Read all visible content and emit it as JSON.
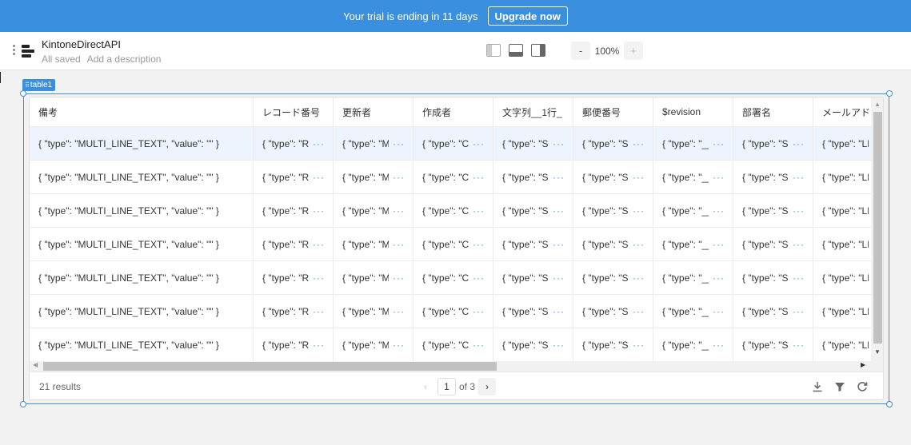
{
  "banner": {
    "text": "Your trial is ending in 11 days",
    "upgrade_label": "Upgrade now"
  },
  "header": {
    "app_name": "KintoneDirectAPI",
    "save_status": "All saved",
    "description_placeholder": "Add a description",
    "zoom": {
      "minus": "-",
      "value": "100%",
      "plus": "+"
    }
  },
  "component": {
    "tag_label": "table1"
  },
  "table": {
    "columns": [
      "備考",
      "レコード番号",
      "更新者",
      "作成者",
      "文字列__1行_",
      "郵便番号",
      "$revision",
      "部署名",
      "メールアドレス"
    ],
    "rows": [
      [
        "{ \"type\": \"MULTI_LINE_TEXT\", \"value\": \"\" }",
        "{ \"type\": \"RECORD_NUMBER\"",
        "{ \"type\": \"MODIFIER\"",
        "{ \"type\": \"CREATOR\"",
        "{ \"type\": \"SINGLE_LINE_TEXT\"",
        "{ \"type\": \"SINGLE_LINE_TEXT\"",
        "{ \"type\": \"__REVISION__\"",
        "{ \"type\": \"SINGLE_LINE_TEXT\"",
        "{ \"type\": \"LINK\""
      ],
      [
        "{ \"type\": \"MULTI_LINE_TEXT\", \"value\": \"\" }",
        "{ \"type\": \"RECORD_NUMBER\"",
        "{ \"type\": \"MODIFIER\"",
        "{ \"type\": \"CREATOR\"",
        "{ \"type\": \"SINGLE_LINE_TEXT\"",
        "{ \"type\": \"SINGLE_LINE_TEXT\"",
        "{ \"type\": \"__REVISION__\"",
        "{ \"type\": \"SINGLE_LINE_TEXT\"",
        "{ \"type\": \"LINK\""
      ],
      [
        "{ \"type\": \"MULTI_LINE_TEXT\", \"value\": \"\" }",
        "{ \"type\": \"RECORD_NUMBER\"",
        "{ \"type\": \"MODIFIER\"",
        "{ \"type\": \"CREATOR\"",
        "{ \"type\": \"SINGLE_LINE_TEXT\"",
        "{ \"type\": \"SINGLE_LINE_TEXT\"",
        "{ \"type\": \"__REVISION__\"",
        "{ \"type\": \"SINGLE_LINE_TEXT\"",
        "{ \"type\": \"LINK\""
      ],
      [
        "{ \"type\": \"MULTI_LINE_TEXT\", \"value\": \"\" }",
        "{ \"type\": \"RECORD_NUMBER\"",
        "{ \"type\": \"MODIFIER\"",
        "{ \"type\": \"CREATOR\"",
        "{ \"type\": \"SINGLE_LINE_TEXT\"",
        "{ \"type\": \"SINGLE_LINE_TEXT\"",
        "{ \"type\": \"__REVISION__\"",
        "{ \"type\": \"SINGLE_LINE_TEXT\"",
        "{ \"type\": \"LINK\""
      ],
      [
        "{ \"type\": \"MULTI_LINE_TEXT\", \"value\": \"\" }",
        "{ \"type\": \"RECORD_NUMBER\"",
        "{ \"type\": \"MODIFIER\"",
        "{ \"type\": \"CREATOR\"",
        "{ \"type\": \"SINGLE_LINE_TEXT\"",
        "{ \"type\": \"SINGLE_LINE_TEXT\"",
        "{ \"type\": \"__REVISION__\"",
        "{ \"type\": \"SINGLE_LINE_TEXT\"",
        "{ \"type\": \"LINK\""
      ],
      [
        "{ \"type\": \"MULTI_LINE_TEXT\", \"value\": \"\" }",
        "{ \"type\": \"RECORD_NUMBER\"",
        "{ \"type\": \"MODIFIER\"",
        "{ \"type\": \"CREATOR\"",
        "{ \"type\": \"SINGLE_LINE_TEXT\"",
        "{ \"type\": \"SINGLE_LINE_TEXT\"",
        "{ \"type\": \"__REVISION__\"",
        "{ \"type\": \"SINGLE_LINE_TEXT\"",
        "{ \"type\": \"LINK\""
      ],
      [
        "{ \"type\": \"MULTI_LINE_TEXT\", \"value\": \"\" }",
        "{ \"type\": \"RECORD_NUMBER\"",
        "{ \"type\": \"MODIFIER\"",
        "{ \"type\": \"CREATOR\"",
        "{ \"type\": \"SINGLE_LINE_TEXT\"",
        "{ \"type\": \"SINGLE_LINE_TEXT\"",
        "{ \"type\": \"__REVISION__\"",
        "{ \"type\": \"SINGLE_LINE_TEXT\"",
        "{ \"type\": \"LINK\""
      ]
    ],
    "more_glyph": "···",
    "selected_row": 0
  },
  "footer": {
    "results": "21 results",
    "current_page": "1",
    "page_total": "of 3"
  },
  "icons": {
    "download": "download-icon",
    "filter": "filter-icon",
    "refresh": "refresh-icon"
  },
  "colors": {
    "accent": "#3b8fdf",
    "selected_row": "#edf4fd"
  }
}
